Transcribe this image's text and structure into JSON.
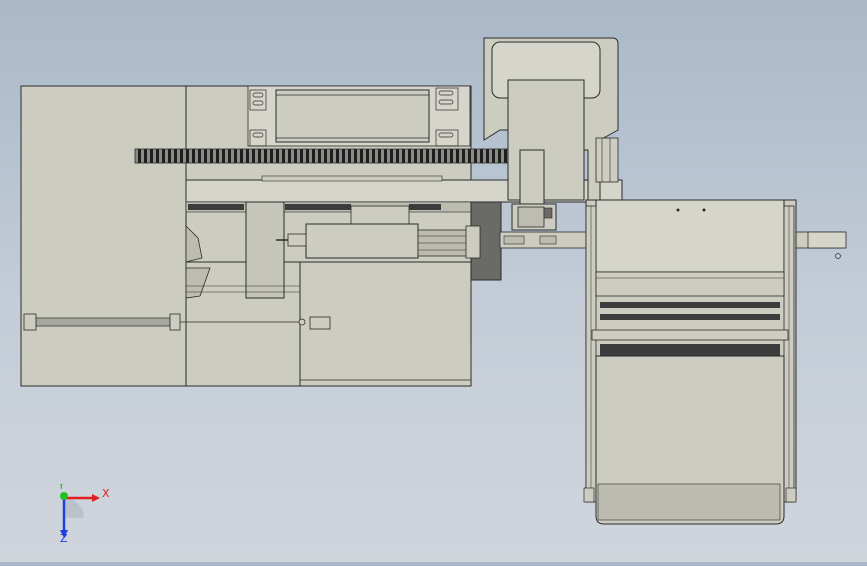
{
  "viewport": {
    "background_top": "#aab8c8",
    "background_bottom": "#d0d5dc"
  },
  "colors": {
    "part_fill": "#cdccc1",
    "part_fill_light": "#d6d5cb",
    "part_fill_dark": "#bdbcb1",
    "edge": "#2b2b2b",
    "dark_slot": "#3c3c3c",
    "dark_panel": "#6a6a66",
    "gear_teeth": "#1e1e1e"
  },
  "triad": {
    "x_label": "X",
    "y_label": "Y",
    "z_label": "Z",
    "x_color": "#e02020",
    "y_color": "#20c020",
    "z_color": "#2040e0"
  }
}
